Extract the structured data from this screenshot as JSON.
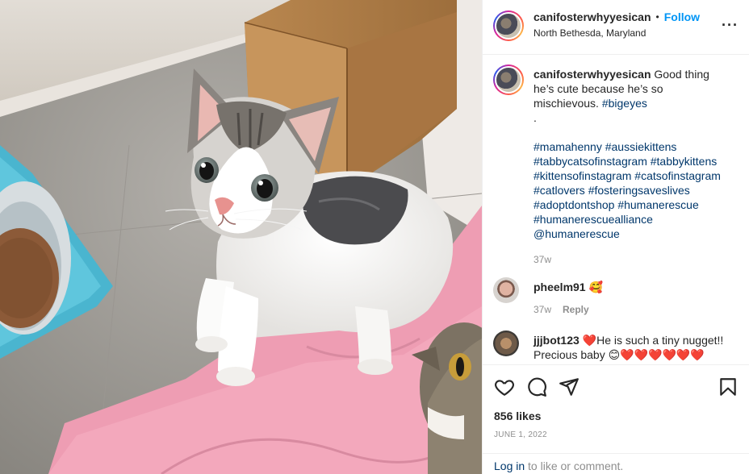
{
  "post": {
    "username": "canifosterwhyyesican",
    "separator": "•",
    "follow_label": "Follow",
    "location": "North Bethesda, Maryland",
    "more_icon": "more-horizontal-icon"
  },
  "caption": {
    "username": "canifosterwhyyesican",
    "text": "Good thing he’s cute because he’s so mischievous.",
    "inline_tag": "#bigeyes",
    "dot": ".",
    "hashtags": [
      "#mamahenny",
      "#aussiekittens",
      "#tabbycatsofinstagram",
      "#tabbykittens",
      "#kittensofinstagram",
      "#catsofinstagram",
      "#catlovers",
      "#fosteringsaveslives",
      "#adoptdontshop",
      "#humanerescue",
      "#humanerescuealliance"
    ],
    "mention": "@humanerescue",
    "time": "37w"
  },
  "comments": [
    {
      "username": "pheelm91",
      "text": "🥰",
      "time": "37w",
      "reply_label": "Reply"
    },
    {
      "username": "jjjbot123",
      "text": "❤️He is such a tiny nugget!! Precious baby 😊❤️❤️❤️❤️❤️❤️"
    }
  ],
  "actions": {
    "like_icon": "heart-icon",
    "comment_icon": "comment-icon",
    "share_icon": "share-icon",
    "save_icon": "bookmark-icon",
    "likes": "856 likes",
    "date": "JUNE 1, 2022"
  },
  "login": {
    "link": "Log in",
    "text": " to like or comment."
  },
  "colors": {
    "link_blue": "#0095f6",
    "hashtag": "#00376b",
    "muted": "#8e8e8e",
    "border": "#efefef"
  }
}
